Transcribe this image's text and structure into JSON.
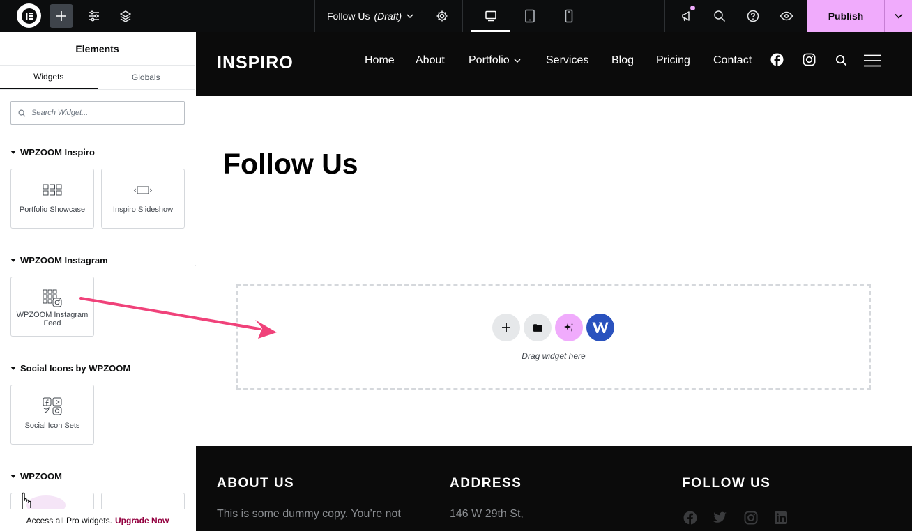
{
  "topbar": {
    "document_title": "Follow Us",
    "document_status": "(Draft)",
    "publish_label": "Publish",
    "accent_color": "#f0abfc"
  },
  "panel": {
    "title": "Elements",
    "tabs": [
      "Widgets",
      "Globals"
    ],
    "search_placeholder": "Search Widget...",
    "categories": [
      {
        "name": "WPZOOM Inspiro",
        "widgets": [
          "Portfolio Showcase",
          "Inspiro Slideshow"
        ]
      },
      {
        "name": "WPZOOM Instagram",
        "widgets": [
          "WPZOOM Instagram Feed"
        ]
      },
      {
        "name": "Social Icons by WPZOOM",
        "widgets": [
          "Social Icon Sets"
        ]
      },
      {
        "name": "WPZOOM",
        "widgets": []
      }
    ],
    "upgrade_text": "Access all Pro widgets.",
    "upgrade_link": "Upgrade Now"
  },
  "site": {
    "logo": "INSPIRO",
    "nav": [
      "Home",
      "About",
      "Portfolio",
      "Services",
      "Blog",
      "Pricing",
      "Contact"
    ],
    "page_title": "Follow Us",
    "dropzone_label": "Drag widget here",
    "footer": {
      "about_heading": "ABOUT US",
      "about_text": "This is some dummy copy. You’re not",
      "address_heading": "ADDRESS",
      "address_text": "146 W 29th St,",
      "follow_heading": "FOLLOW US"
    }
  },
  "annotation_color": "#f0427a"
}
